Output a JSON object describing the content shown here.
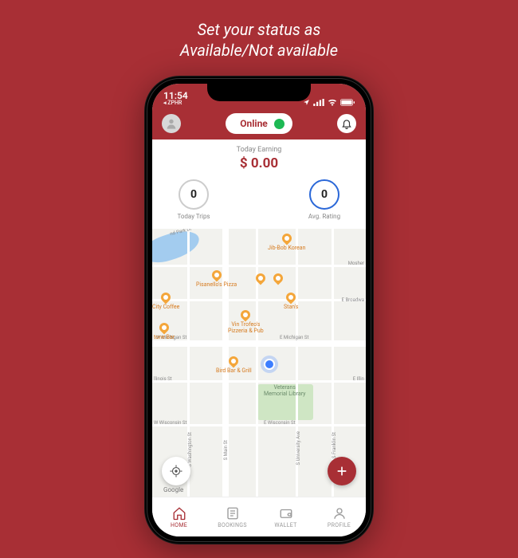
{
  "promo": {
    "line1": "Set your status as",
    "line2": "Available/Not available"
  },
  "statusbar": {
    "time": "11:54",
    "back_app": "◂ ZPHR"
  },
  "header": {
    "status_label": "Online"
  },
  "earning": {
    "label": "Today Earning",
    "amount": "$ 0.00"
  },
  "metrics": {
    "trips_value": "0",
    "trips_label": "Today Trips",
    "rating_value": "0",
    "rating_label": "Avg. Rating"
  },
  "map": {
    "pois": {
      "jibbob": "Jib-Bob Korean",
      "pisanello": "Pisanello's Pizza",
      "citycoffee": "City Coffee",
      "stans": "Stan's",
      "vintrofeo1": "Vin Trofeo's",
      "vintrofeo2": "Pizzeria & Pub",
      "tonebar": "tone Bar",
      "birdbar": "Bird Bar & Grill",
      "vetlib1": "Veterans",
      "vetlib2": "Memorial Library",
      "park": "nd Park Dr"
    },
    "streets": {
      "michigan_w": "W Michigan St",
      "michigan_e": "E Michigan St",
      "mosher": "Mosher",
      "broadwa": "E Broadwa",
      "illinois": "llinois St",
      "eilli": "E Illin",
      "wisconsin_w": "W Wisconsin St",
      "wisconsin_e": "E Wisconsin St",
      "washington": "S Washington St",
      "main": "S Main St",
      "university": "S University Ave",
      "franklin": "S Franklin St"
    },
    "logo": "Google"
  },
  "nav": {
    "home": "HOME",
    "bookings": "BOOKINGS",
    "wallet": "WALLET",
    "profile": "PROFILE"
  }
}
